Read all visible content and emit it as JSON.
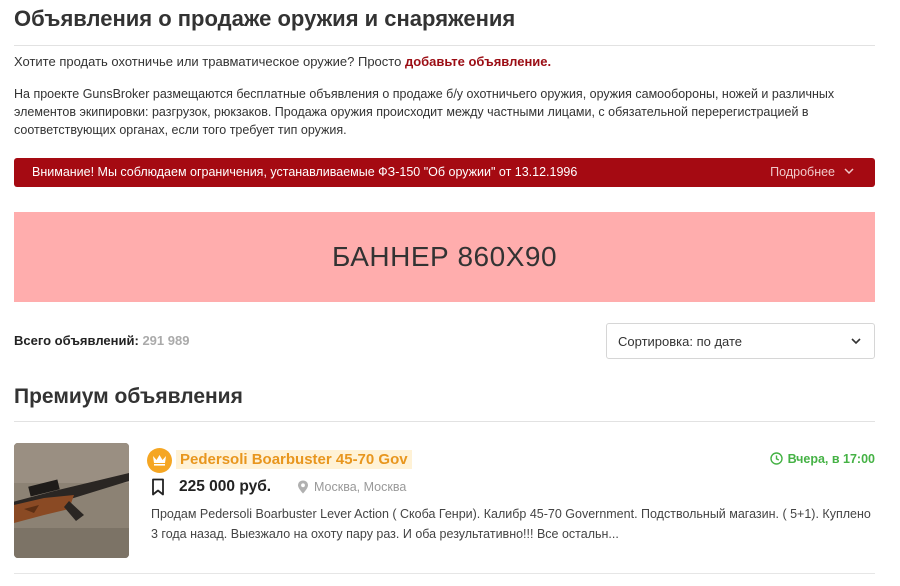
{
  "page": {
    "title": "Объявления о продаже оружия и снаряжения",
    "intro_prefix": "Хотите продать охотничье или травматическое оружие? Просто ",
    "intro_link": "добавьте объявление.",
    "description": "На проекте GunsBroker размещаются бесплатные объявления о продаже б/у охотничьего оружия, оружия самообороны, ножей и различных элементов экипировки: разгрузок, рюкзаков. Продажа оружия происходит между частными лицами, с обязательной перерегистрацией в соответствующих органах, если того требует тип оружия."
  },
  "alert": {
    "text": "Внимание! Мы соблюдаем ограничения, устанавливаемые ФЗ-150 \"Об оружии\" от 13.12.1996",
    "more_label": "Подробнее"
  },
  "banner": {
    "text": "БАННЕР 860X90"
  },
  "listing_meta": {
    "total_label": "Всего объявлений:",
    "total_count": "291 989",
    "sort_label": "Сортировка: по дате"
  },
  "premium": {
    "section_title": "Премиум объявления",
    "items": [
      {
        "title": "Pedersoli Boarbuster 45-70 Gov",
        "date": "Вчера, в 17:00",
        "price": "225 000 руб.",
        "location": "Москва, Москва",
        "description": "Продам Pedersoli Boarbuster Lever Action ( Скоба Генри). Калибр 45-70 Government. Подствольный магазин. ( 5+1). Куплено 3 года назад. Выезжало на охоту пару раз. И оба результативно!!! Все остальн..."
      }
    ]
  },
  "colors": {
    "accent_red": "#a50a12",
    "link_red": "#9b0d14",
    "banner_pink": "#ffadad",
    "premium_orange": "#f5a623",
    "date_green": "#45b245"
  },
  "icons": [
    "chevron-down-icon",
    "crown-icon",
    "clock-icon",
    "bookmark-icon",
    "location-pin-icon"
  ]
}
